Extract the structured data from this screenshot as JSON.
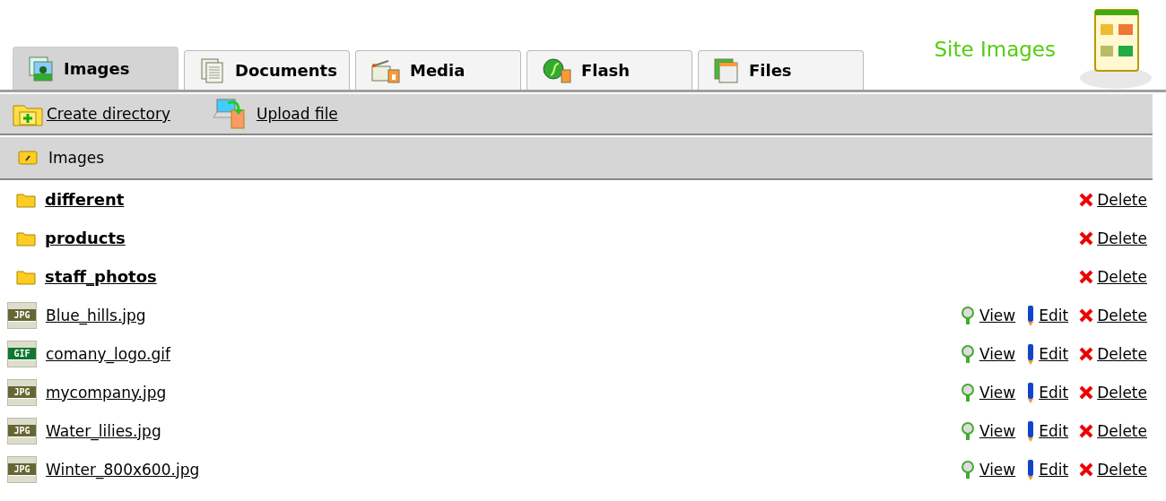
{
  "header": {
    "title": "Site Images"
  },
  "tabs": [
    {
      "label": "Images",
      "kind": "images",
      "selected": true
    },
    {
      "label": "Documents",
      "kind": "documents",
      "selected": false
    },
    {
      "label": "Media",
      "kind": "media",
      "selected": false
    },
    {
      "label": "Flash",
      "kind": "flash",
      "selected": false
    },
    {
      "label": "Files",
      "kind": "files",
      "selected": false
    }
  ],
  "toolbar": [
    {
      "label": "Create directory",
      "kind": "create"
    },
    {
      "label": "Upload file",
      "kind": "upload"
    }
  ],
  "breadcrumb": "Images",
  "items": [
    {
      "kind": "folder",
      "name": "different",
      "actions": [
        {
          "kind": "delete",
          "label": "Delete"
        }
      ]
    },
    {
      "kind": "folder",
      "name": "products",
      "actions": [
        {
          "kind": "delete",
          "label": "Delete"
        }
      ]
    },
    {
      "kind": "folder",
      "name": "staff_photos",
      "actions": [
        {
          "kind": "delete",
          "label": "Delete"
        }
      ]
    },
    {
      "kind": "file",
      "badge": "JPG",
      "name": "Blue_hills.jpg",
      "actions": [
        {
          "kind": "view",
          "label": "View"
        },
        {
          "kind": "edit",
          "label": "Edit"
        },
        {
          "kind": "delete",
          "label": "Delete"
        }
      ]
    },
    {
      "kind": "file",
      "badge": "GIF",
      "name": "comany_logo.gif",
      "actions": [
        {
          "kind": "view",
          "label": "View"
        },
        {
          "kind": "edit",
          "label": "Edit"
        },
        {
          "kind": "delete",
          "label": "Delete"
        }
      ]
    },
    {
      "kind": "file",
      "badge": "JPG",
      "name": "mycompany.jpg",
      "actions": [
        {
          "kind": "view",
          "label": "View"
        },
        {
          "kind": "edit",
          "label": "Edit"
        },
        {
          "kind": "delete",
          "label": "Delete"
        }
      ]
    },
    {
      "kind": "file",
      "badge": "JPG",
      "name": "Water_lilies.jpg",
      "actions": [
        {
          "kind": "view",
          "label": "View"
        },
        {
          "kind": "edit",
          "label": "Edit"
        },
        {
          "kind": "delete",
          "label": "Delete"
        }
      ]
    },
    {
      "kind": "file",
      "badge": "JPG",
      "name": "Winter_800x600.jpg",
      "actions": [
        {
          "kind": "view",
          "label": "View"
        },
        {
          "kind": "edit",
          "label": "Edit"
        },
        {
          "kind": "delete",
          "label": "Delete"
        }
      ]
    }
  ]
}
